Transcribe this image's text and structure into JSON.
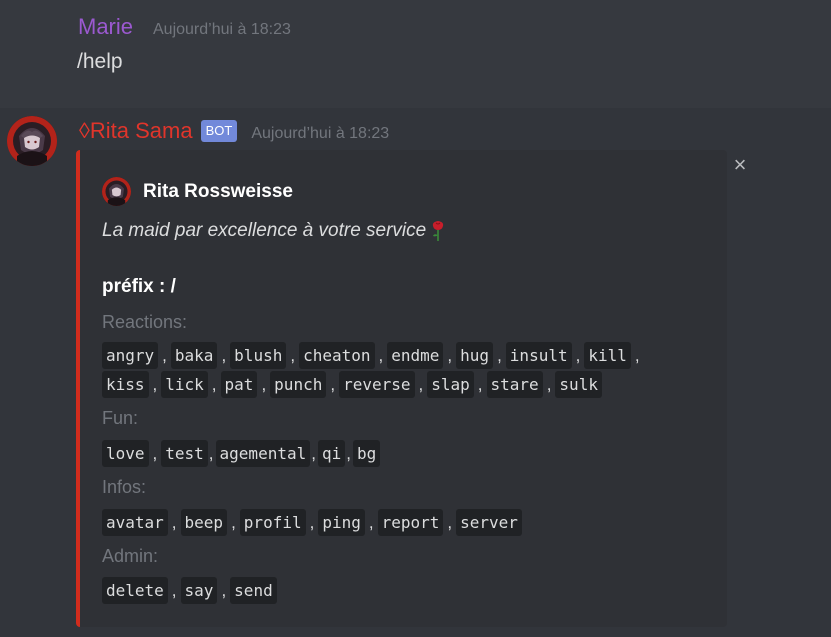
{
  "message1": {
    "author": "Marie",
    "timestamp": "Aujourd’hui à 18:23",
    "content": "/help"
  },
  "message2": {
    "author": "◊Rita Sama",
    "bot_tag": "BOT",
    "timestamp": "Aujourd’hui à 18:23",
    "embed": {
      "author_name": "Rita Rossweisse",
      "description": "La maid par excellence à votre service",
      "prefix": "préfix : /",
      "fields": [
        {
          "title": "Reactions:",
          "rows": [
            [
              "angry",
              "baka",
              "blush",
              "cheaton",
              "endme",
              "hug",
              "insult",
              "kill"
            ],
            [
              "kiss",
              "lick",
              "pat",
              "punch",
              "reverse",
              "slap",
              "stare",
              "sulk"
            ]
          ]
        },
        {
          "title": "Fun:",
          "rows": [
            [
              "love",
              "test",
              "agemental",
              "qi",
              "bg"
            ]
          ]
        },
        {
          "title": "Infos:",
          "rows": [
            [
              "avatar",
              "beep",
              "profil",
              "ping",
              "report",
              "server"
            ]
          ]
        },
        {
          "title": "Admin:",
          "rows": [
            [
              "delete",
              "say",
              "send"
            ]
          ]
        }
      ],
      "accent_color": "#d12c1d"
    },
    "close_icon": "close-icon"
  },
  "colors": {
    "background": "#36393f",
    "hover_background": "#32353b",
    "embed_background": "#2f3136",
    "marie_name": "#9b59d0",
    "rita_name": "#e0352b",
    "bot_tag": "#7289da",
    "timestamp": "#72767d",
    "code_background": "#202225"
  }
}
